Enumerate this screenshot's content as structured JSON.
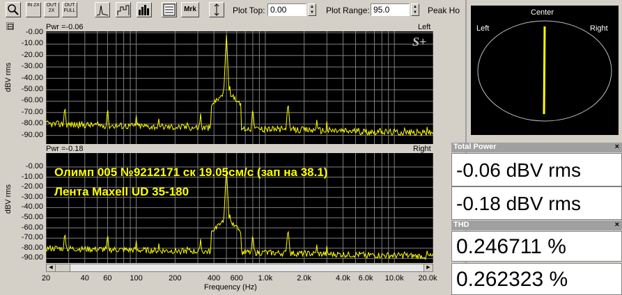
{
  "toolbar": {
    "btn_zoom": "",
    "btn_in2x": "IN 2X",
    "btn_out2x": "OUT 2X",
    "btn_outfull": "OUT FULL",
    "btn_mrk": "Mrk",
    "plot_top_label": "Plot Top:",
    "plot_top_value": "0.00",
    "plot_range_label": "Plot Range:",
    "plot_range_value": "95.0",
    "peak_hold_label": "Peak Ho"
  },
  "top_plot": {
    "collapse": "⊟",
    "pwr": "Pwr =-0.06",
    "channel": "Left",
    "ylabel": "dBV rms",
    "watermark": "S+",
    "yticks": [
      "-0.00",
      "-10.00",
      "-20.00",
      "-30.00",
      "-40.00",
      "-50.00",
      "-60.00",
      "-70.00",
      "-80.00",
      "-90.00"
    ]
  },
  "bottom_plot": {
    "pwr": "Pwr =-0.18",
    "channel": "Right",
    "ylabel": "dBV rms",
    "yticks": [
      "-0.00",
      "-10.00",
      "-20.00",
      "-30.00",
      "-40.00",
      "-50.00",
      "-60.00",
      "-70.00",
      "-80.00",
      "-90.00"
    ],
    "annotation_line1": "Олимп 005 №9212171      ск 19.05см/с (зап на 38.1)",
    "annotation_line2": "Лента Maxell UD 35-180"
  },
  "xaxis": {
    "label": "Frequency (Hz)",
    "ticks": [
      "20",
      "40",
      "60",
      "100",
      "200",
      "400",
      "600",
      "1.0k",
      "2.0k",
      "4.0k",
      "6.0k",
      "10.0k",
      "20.0k"
    ]
  },
  "phase_scope": {
    "left": "Left",
    "center": "Center",
    "right": "Right"
  },
  "total_power": {
    "title": "Total Power",
    "close": "×",
    "values": [
      "-0.06 dBV rms",
      "-0.18 dBV rms"
    ]
  },
  "thd": {
    "title": "THD",
    "close": "×",
    "values": [
      "0.246711 %",
      "0.262323 %"
    ]
  },
  "colors": {
    "trace": "#ffff00",
    "grid": "#808080",
    "plot_bg": "#000000"
  }
}
